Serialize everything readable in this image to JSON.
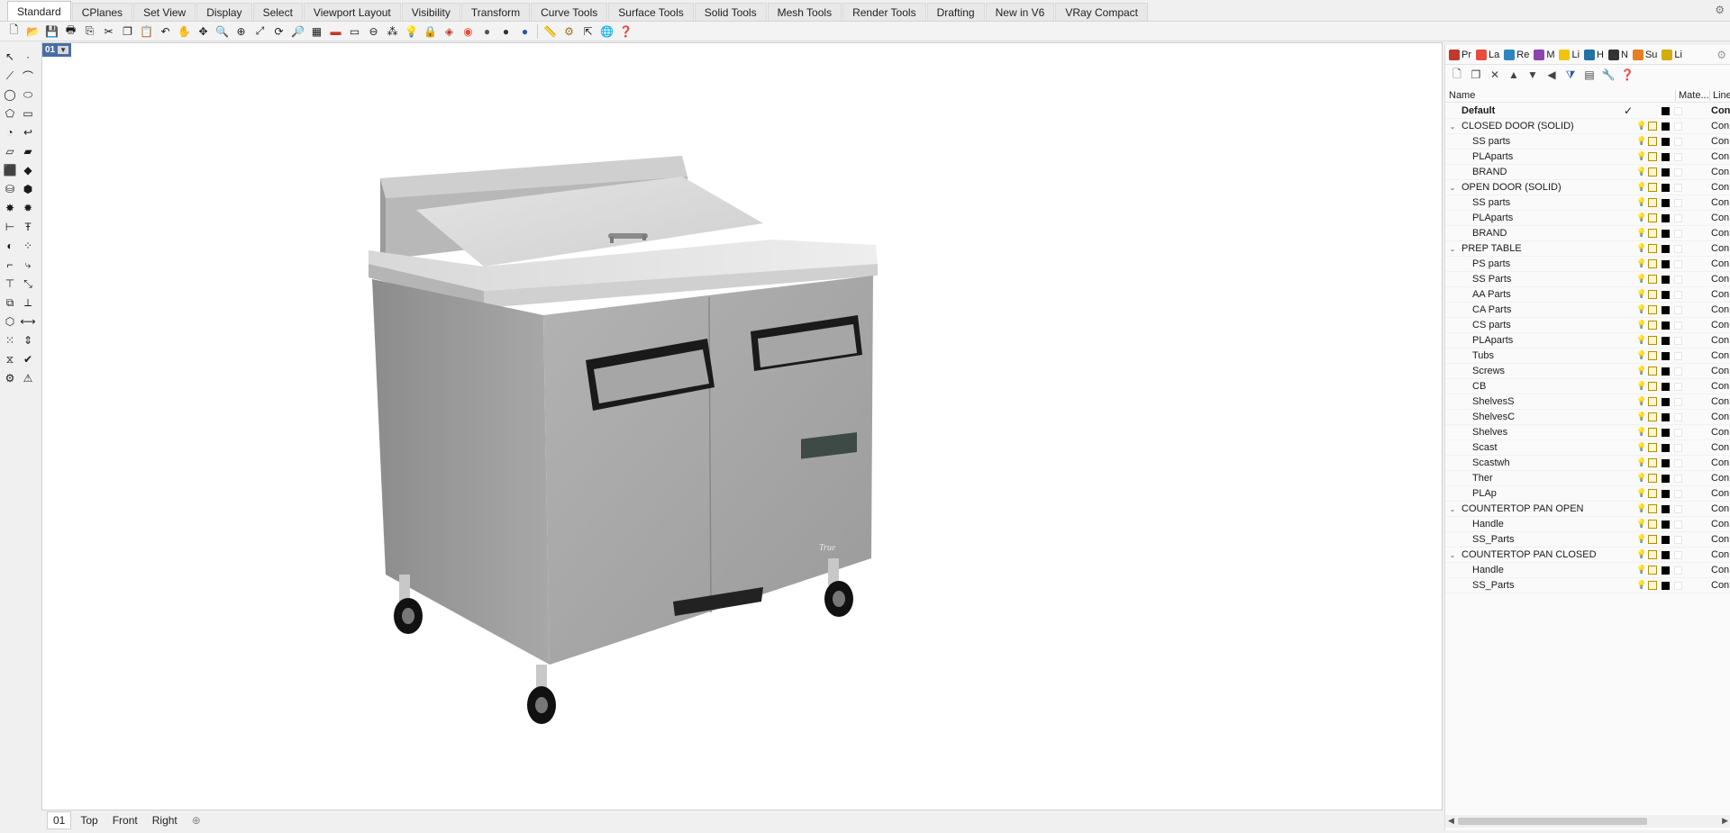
{
  "tabs": [
    "Standard",
    "CPlanes",
    "Set View",
    "Display",
    "Select",
    "Viewport Layout",
    "Visibility",
    "Transform",
    "Curve Tools",
    "Surface Tools",
    "Solid Tools",
    "Mesh Tools",
    "Render Tools",
    "Drafting",
    "New in V6",
    "VRay Compact"
  ],
  "active_tab": "Standard",
  "viewport": {
    "label": "01"
  },
  "viewport_tabs": [
    "01",
    "Top",
    "Front",
    "Right"
  ],
  "panel": {
    "tabs": [
      {
        "label": "Pr",
        "color": "#c0392b"
      },
      {
        "label": "La",
        "color": "#e74c3c"
      },
      {
        "label": "Re",
        "color": "#2e86c1"
      },
      {
        "label": "M",
        "color": "#8e44ad"
      },
      {
        "label": "Li",
        "color": "#f1c40f"
      },
      {
        "label": "H",
        "color": "#2471a3"
      },
      {
        "label": "N",
        "color": "#333333"
      },
      {
        "label": "Su",
        "color": "#e67e22"
      },
      {
        "label": "Li",
        "color": "#d4ac0d"
      }
    ],
    "columns": {
      "name": "Name",
      "material": "Mate...",
      "linetype": "Line"
    },
    "layers": [
      {
        "name": "Default",
        "level": 0,
        "bold": true,
        "current": true,
        "linetype": "Con"
      },
      {
        "name": "CLOSED DOOR (SOLID)",
        "level": 0,
        "expanded": true,
        "linetype": "Con"
      },
      {
        "name": "SS parts",
        "level": 1,
        "linetype": "Con"
      },
      {
        "name": "PLAparts",
        "level": 1,
        "linetype": "Con"
      },
      {
        "name": "BRAND",
        "level": 1,
        "linetype": "Con"
      },
      {
        "name": "OPEN DOOR (SOLID)",
        "level": 0,
        "expanded": true,
        "linetype": "Con"
      },
      {
        "name": "SS parts",
        "level": 1,
        "linetype": "Con"
      },
      {
        "name": "PLAparts",
        "level": 1,
        "linetype": "Con"
      },
      {
        "name": "BRAND",
        "level": 1,
        "linetype": "Con"
      },
      {
        "name": "PREP TABLE",
        "level": 0,
        "expanded": true,
        "linetype": "Con"
      },
      {
        "name": "PS parts",
        "level": 1,
        "linetype": "Con"
      },
      {
        "name": "SS Parts",
        "level": 1,
        "linetype": "Con"
      },
      {
        "name": "AA Parts",
        "level": 1,
        "linetype": "Con"
      },
      {
        "name": "CA Parts",
        "level": 1,
        "linetype": "Con"
      },
      {
        "name": "CS parts",
        "level": 1,
        "linetype": "Con"
      },
      {
        "name": "PLAparts",
        "level": 1,
        "linetype": "Con"
      },
      {
        "name": "Tubs",
        "level": 1,
        "linetype": "Con"
      },
      {
        "name": "Screws",
        "level": 1,
        "linetype": "Con"
      },
      {
        "name": "CB",
        "level": 1,
        "linetype": "Con"
      },
      {
        "name": "ShelvesS",
        "level": 1,
        "linetype": "Con"
      },
      {
        "name": "ShelvesC",
        "level": 1,
        "linetype": "Con"
      },
      {
        "name": "Shelves",
        "level": 1,
        "linetype": "Con"
      },
      {
        "name": "Scast",
        "level": 1,
        "linetype": "Con"
      },
      {
        "name": "Scastwh",
        "level": 1,
        "linetype": "Con"
      },
      {
        "name": "Ther",
        "level": 1,
        "linetype": "Con"
      },
      {
        "name": "PLAp",
        "level": 1,
        "linetype": "Con"
      },
      {
        "name": "COUNTERTOP PAN OPEN",
        "level": 0,
        "expanded": true,
        "linetype": "Con"
      },
      {
        "name": "Handle",
        "level": 1,
        "linetype": "Con"
      },
      {
        "name": "SS_Parts",
        "level": 1,
        "linetype": "Con"
      },
      {
        "name": "COUNTERTOP PAN CLOSED",
        "level": 0,
        "expanded": true,
        "linetype": "Con"
      },
      {
        "name": "Handle",
        "level": 1,
        "linetype": "Con"
      },
      {
        "name": "SS_Parts",
        "level": 1,
        "linetype": "Con"
      }
    ]
  },
  "brand_logo_text": "True"
}
